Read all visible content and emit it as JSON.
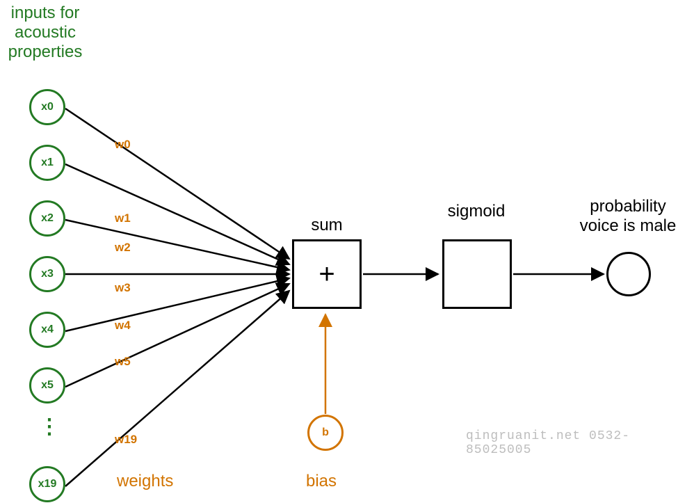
{
  "title_inputs": {
    "line1": "inputs for",
    "line2": "acoustic",
    "line3": "properties"
  },
  "inputs": {
    "x0": "x0",
    "x1": "x1",
    "x2": "x2",
    "x3": "x3",
    "x4": "x4",
    "x5": "x5",
    "x19": "x19"
  },
  "weights": {
    "w0": "w0",
    "w1": "w1",
    "w2": "w2",
    "w3": "w3",
    "w4": "w4",
    "w5": "w5",
    "w19": "w19",
    "label": "weights"
  },
  "bias": {
    "symbol": "b",
    "label": "bias"
  },
  "sum": {
    "label": "sum",
    "symbol": "+"
  },
  "sigmoid": {
    "label": "sigmoid"
  },
  "output": {
    "line1": "probability",
    "line2": "voice is male"
  },
  "ellipsis": "⋮",
  "watermark": "qingruanit.net 0532-85025005"
}
